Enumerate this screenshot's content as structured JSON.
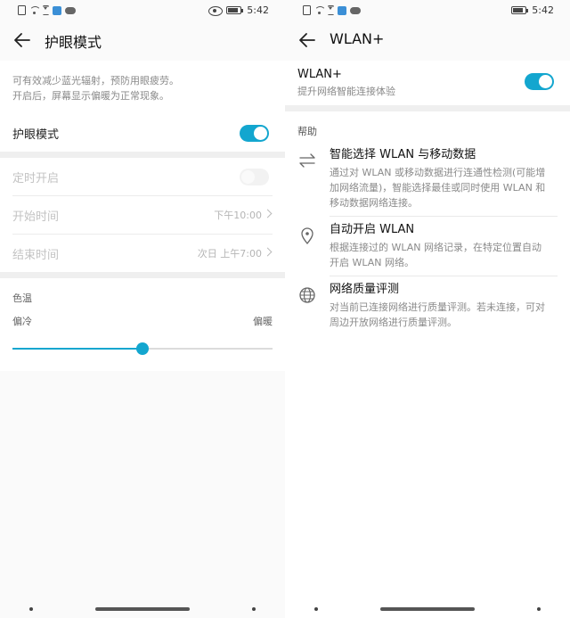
{
  "left_screen": {
    "status": {
      "time": "5:42"
    },
    "header": {
      "title": "护眼模式"
    },
    "description": [
      "可有效减少蓝光辐射，预防用眼疲劳。",
      "开启后，屏幕显示偏暖为正常现象。"
    ],
    "eye_mode": {
      "label": "护眼模式",
      "enabled": true
    },
    "schedule": {
      "label": "定时开启",
      "enabled": false,
      "start": {
        "label": "开始时间",
        "value": "下午10:00"
      },
      "end": {
        "label": "结束时间",
        "value": "次日 上午7:00"
      }
    },
    "color_temp": {
      "label": "色温",
      "cold_label": "偏冷",
      "warm_label": "偏暖",
      "level": 0.5
    }
  },
  "right_screen": {
    "status": {
      "time": "5:42"
    },
    "header": {
      "title": "WLAN+"
    },
    "wlan_plus": {
      "label": "WLAN+",
      "subtitle": "提升网络智能连接体验",
      "enabled": true
    },
    "help": {
      "label": "帮助",
      "items": [
        {
          "icon": "swap-arrows-icon",
          "title": "智能选择 WLAN 与移动数据",
          "lines": [
            "通过对 WLAN 或移动数据进行连通性检测(可能增",
            "加网络流量)，智能选择最佳或同时使用 WLAN 和",
            "移动数据网络连接。"
          ]
        },
        {
          "icon": "location-pin-icon",
          "title": "自动开启 WLAN",
          "lines": [
            "根据连接过的 WLAN 网络记录，在特定位置自动",
            "开启 WLAN 网络。"
          ]
        },
        {
          "icon": "globe-icon",
          "title": "网络质量评测",
          "lines": [
            "对当前已连接网络进行质量评测。若未连接，可对",
            "周边开放网络进行质量评测。"
          ]
        }
      ]
    }
  },
  "colors": {
    "accent": "#13a6cf"
  }
}
